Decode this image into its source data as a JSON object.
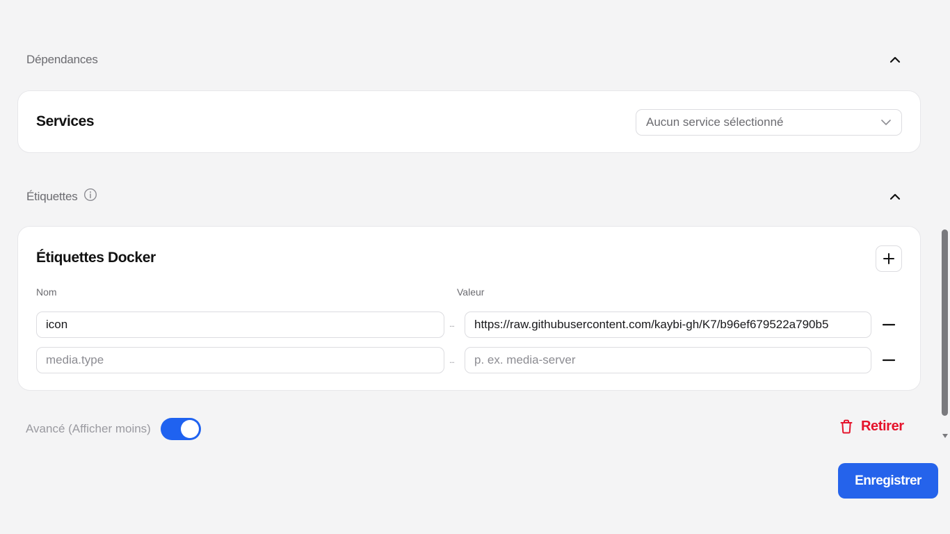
{
  "dependencies": {
    "title": "Dépendances",
    "services_label": "Services",
    "services_select": "Aucun service sélectionné"
  },
  "labels": {
    "title": "Étiquettes",
    "card_title": "Étiquettes Docker",
    "col_name": "Nom",
    "col_value": "Valeur",
    "separator": "...",
    "rows": [
      {
        "name": "icon",
        "name_placeholder": "",
        "value": "https://raw.githubusercontent.com/kaybi-gh/K7/b96ef679522a790b5",
        "value_placeholder": ""
      },
      {
        "name": "",
        "name_placeholder": "media.type",
        "value": "",
        "value_placeholder": "p. ex. media-server"
      }
    ]
  },
  "advanced": {
    "label": "Avancé (Afficher moins)",
    "enabled": true
  },
  "actions": {
    "remove_label": "Retirer",
    "save_label": "Enregistrer"
  },
  "colors": {
    "accent": "#2563eb",
    "danger": "#e5132b"
  }
}
